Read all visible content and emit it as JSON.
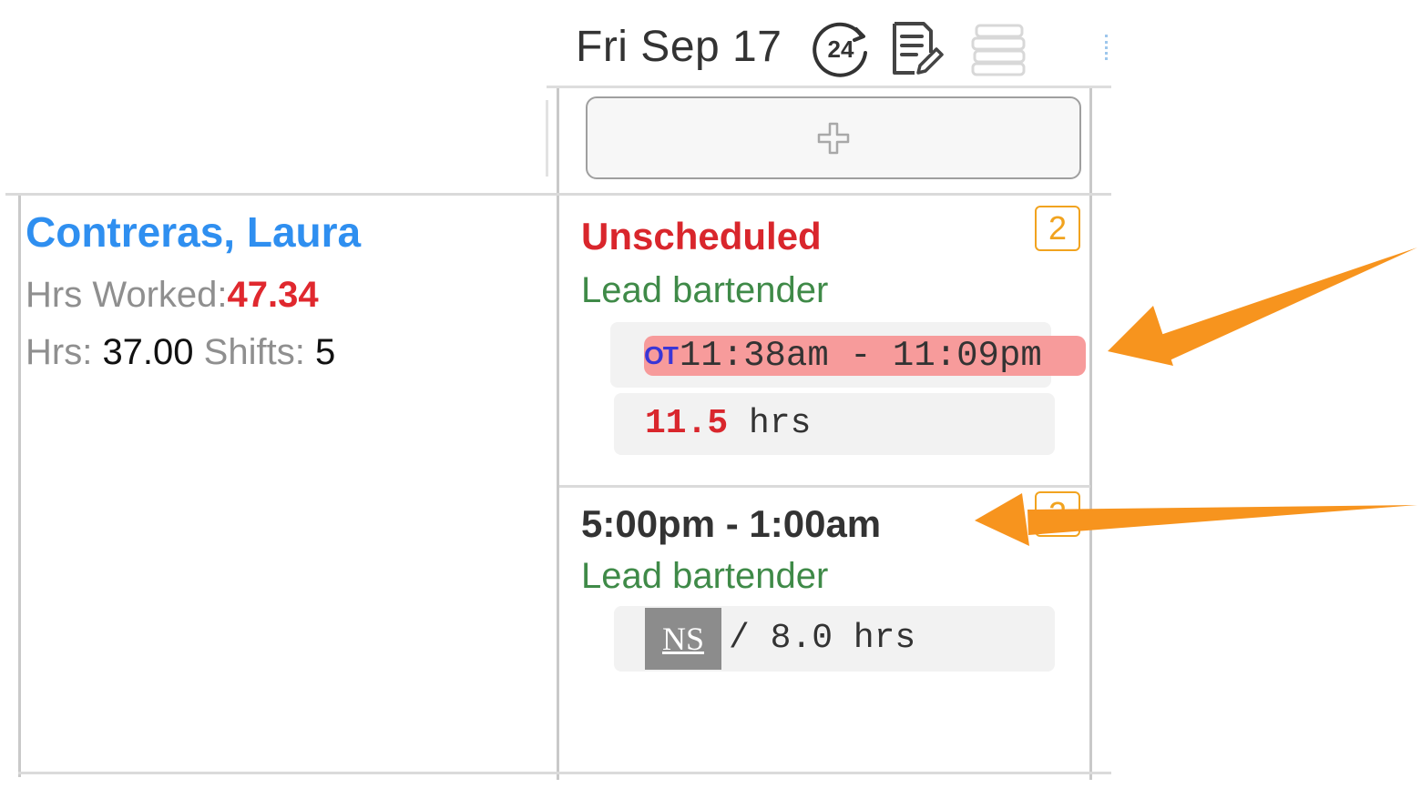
{
  "header": {
    "day_label": "Fri Sep 17",
    "icons": [
      "24-hour-icon",
      "notes-edit-icon",
      "stack-icon"
    ]
  },
  "employee": {
    "name": "Contreras, Laura",
    "hrs_worked_label": "Hrs Worked:",
    "hrs_worked_value": "47.34",
    "hrs_label": "Hrs: ",
    "hrs_value": "37.00",
    "shifts_label": " Shifts: ",
    "shifts_value": "5"
  },
  "shifts": [
    {
      "status": "Unscheduled",
      "role": "Lead bartender",
      "badge": "2",
      "ot_tag": "OT",
      "punch_time": "11:38am - 11:09pm",
      "hours_value": "11.5",
      "hours_unit": " hrs"
    },
    {
      "status": "5:00pm - 1:00am",
      "role": "Lead bartender",
      "badge": "2",
      "no_show": "NS",
      "hours_text": " / 8.0 hrs"
    }
  ],
  "colors": {
    "name_blue": "#2f8ff0",
    "alert_red": "#d9262c",
    "role_green": "#3f8a48",
    "badge_orange": "#f1a31f",
    "ot_pill": "#f79b9b",
    "annotation_arrow": "#f7941e"
  }
}
